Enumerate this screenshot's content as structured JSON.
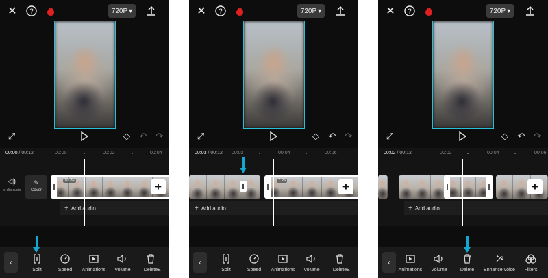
{
  "accent_color": "#13a8d0",
  "selection_color": "#27c0d8",
  "panels": [
    {
      "resolution": "720P",
      "timecode": {
        "current": "00:00",
        "total": "/ 00:12"
      },
      "ticks": [
        "00:00",
        "00:02",
        "00:04"
      ],
      "mute_label": "te clip audio",
      "cover_label": "Cover",
      "clip_duration": "10.8s",
      "add_audio": "Add audio",
      "toolbar": [
        "Split",
        "Speed",
        "Animations",
        "Volume",
        "Delete",
        "E"
      ]
    },
    {
      "resolution": "720P",
      "timecode": {
        "current": "00:03",
        "total": "/ 00:12"
      },
      "ticks": [
        "00:02",
        "00:04",
        "00:06"
      ],
      "clip_duration": "7.2s",
      "add_audio": "Add audio",
      "toolbar": [
        "Split",
        "Speed",
        "Animations",
        "Volume",
        "Delete",
        "E"
      ]
    },
    {
      "resolution": "720P",
      "timecode": {
        "current": "00:02",
        "total": "/ 00:12"
      },
      "ticks": [
        "00:02",
        "00:04",
        "00:06"
      ],
      "add_audio": "Add audio",
      "toolbar": [
        "Animations",
        "Volume",
        "Delete",
        "Enhance voice",
        "Filters"
      ]
    }
  ],
  "icons": {
    "close": "✕",
    "help": "?",
    "flame": "🔥",
    "export": "⤒",
    "dropdown": "▾",
    "fullscreen": "⤢",
    "play": "▷",
    "keyframe": "◇",
    "undo": "↶",
    "redo": "↷",
    "back": "‹",
    "add": "+",
    "mute": "🔈",
    "edit": "✎"
  }
}
